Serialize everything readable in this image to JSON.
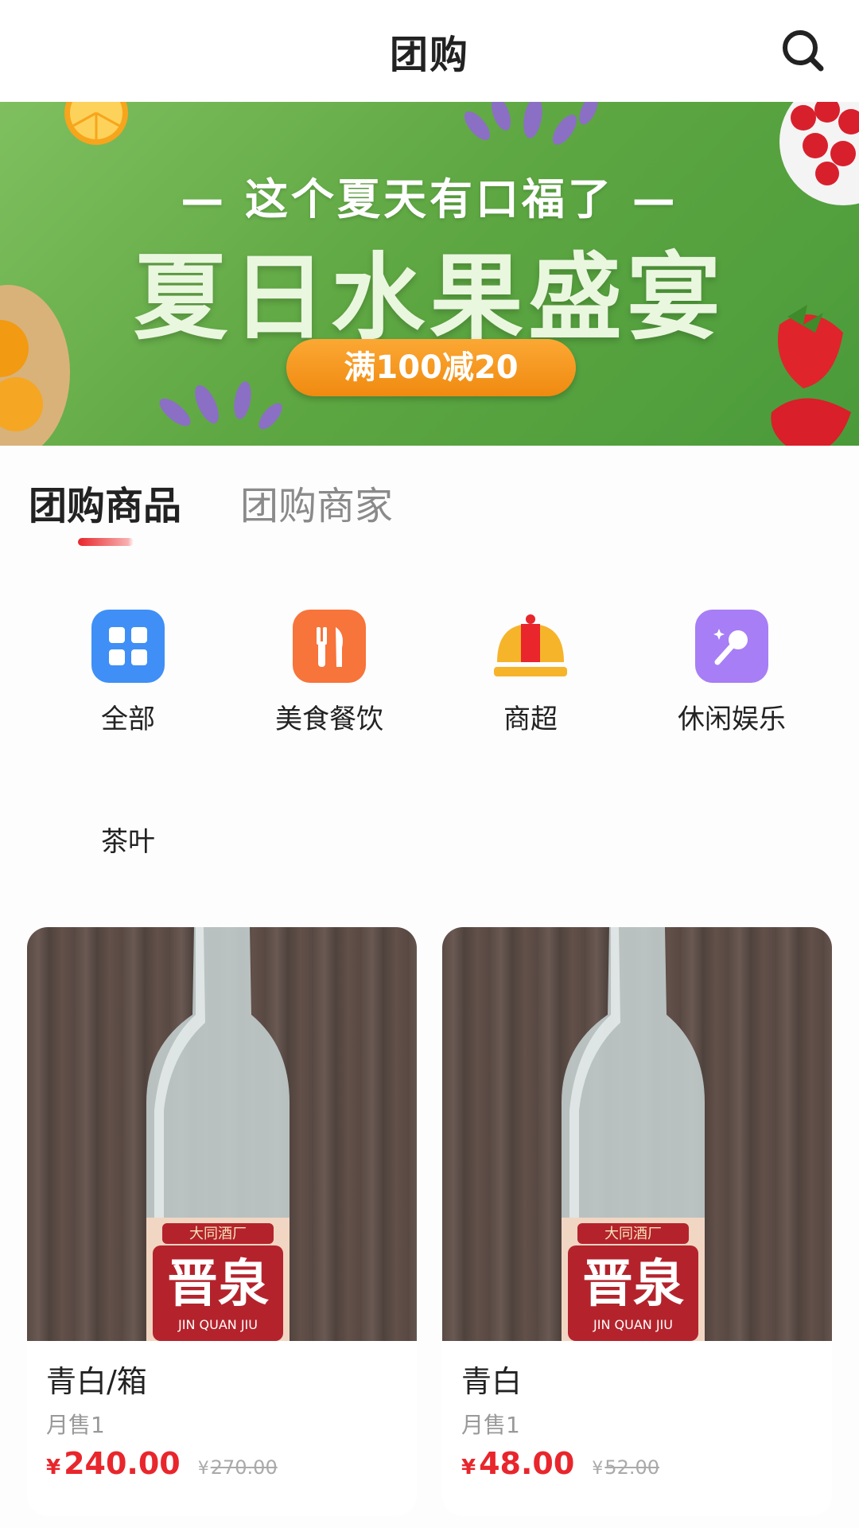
{
  "header": {
    "title": "团购"
  },
  "banner": {
    "subtitle": "— 这个夏天有口福了 —",
    "headline": "夏日水果盛宴",
    "promo": "满100减20"
  },
  "tabs": [
    {
      "label": "团购商品",
      "active": true
    },
    {
      "label": "团购商家",
      "active": false
    }
  ],
  "categories": [
    {
      "label": "全部",
      "icon": "grid-icon",
      "color": "#3f8ff6"
    },
    {
      "label": "美食餐饮",
      "icon": "fork-knife-icon",
      "color": "#f7743b"
    },
    {
      "label": "商超",
      "icon": "cloche-icon",
      "color": "#f0b33a"
    },
    {
      "label": "休闲娱乐",
      "icon": "microphone-icon",
      "color": "#a77ef5"
    },
    {
      "label": "茶叶"
    }
  ],
  "products": [
    {
      "name": "青白/箱",
      "sales": "月售1",
      "currency": "¥",
      "price": "240.00",
      "original_price": "270.00"
    },
    {
      "name": "青白",
      "sales": "月售1",
      "currency": "¥",
      "price": "48.00",
      "original_price": "52.00"
    }
  ],
  "bottle_label": {
    "brand": "晋泉",
    "maker": "大同酒厂",
    "pinyin": "JIN QUAN JIU"
  },
  "colors": {
    "accent": "#e8262c",
    "promo": "#f08a10",
    "banner_green": "#5fa843"
  }
}
